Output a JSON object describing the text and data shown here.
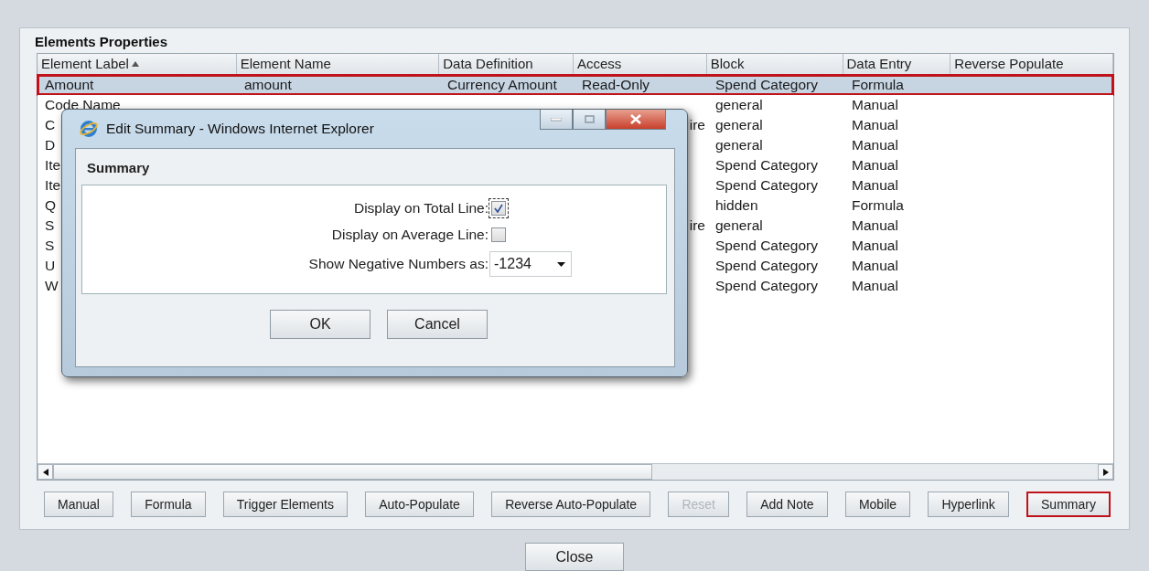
{
  "panel": {
    "title": "Elements Properties"
  },
  "table": {
    "columns": [
      {
        "label": "Element Label",
        "sorted": true
      },
      {
        "label": "Element Name",
        "sorted": false
      },
      {
        "label": "Data Definition",
        "sorted": false
      },
      {
        "label": "Access",
        "sorted": false
      },
      {
        "label": "Block",
        "sorted": false
      },
      {
        "label": "Data Entry",
        "sorted": false
      },
      {
        "label": "Reverse Populate",
        "sorted": false
      }
    ],
    "rows": [
      {
        "selected": true,
        "label": "Amount",
        "name": "amount",
        "definition": "Currency Amount",
        "access": "Read-Only",
        "block": "Spend Category",
        "entry": "Formula"
      },
      {
        "selected": false,
        "label": "Code Name",
        "block": "general",
        "entry": "Manual"
      },
      {
        "selected": false,
        "label": "C",
        "access": "ire",
        "block": "general",
        "entry": "Manual"
      },
      {
        "selected": false,
        "label": "D",
        "block": "general",
        "entry": "Manual"
      },
      {
        "selected": false,
        "label": "Ite",
        "block": "Spend Category",
        "entry": "Manual"
      },
      {
        "selected": false,
        "label": "Ite",
        "block": "Spend Category",
        "entry": "Manual"
      },
      {
        "selected": false,
        "label": "Q",
        "block": "hidden",
        "entry": "Formula"
      },
      {
        "selected": false,
        "label": "S",
        "access": "ire",
        "block": "general",
        "entry": "Manual"
      },
      {
        "selected": false,
        "label": "S",
        "block": "Spend Category",
        "entry": "Manual"
      },
      {
        "selected": false,
        "label": "U",
        "block": "Spend Category",
        "entry": "Manual"
      },
      {
        "selected": false,
        "label": "W",
        "block": "Spend Category",
        "entry": "Manual"
      }
    ]
  },
  "buttons": [
    {
      "label": "Manual",
      "disabled": false,
      "selected": false
    },
    {
      "label": "Formula",
      "disabled": false,
      "selected": false
    },
    {
      "label": "Trigger Elements",
      "disabled": false,
      "selected": false
    },
    {
      "label": "Auto-Populate",
      "disabled": false,
      "selected": false
    },
    {
      "label": "Reverse Auto-Populate",
      "disabled": false,
      "selected": false
    },
    {
      "label": "Reset",
      "disabled": true,
      "selected": false
    },
    {
      "label": "Add Note",
      "disabled": false,
      "selected": false
    },
    {
      "label": "Mobile",
      "disabled": false,
      "selected": false
    },
    {
      "label": "Hyperlink",
      "disabled": false,
      "selected": false
    },
    {
      "label": "Summary",
      "disabled": false,
      "selected": true
    }
  ],
  "close_button": "Close",
  "dialog": {
    "title": "Edit Summary - Windows Internet Explorer",
    "heading": "Summary",
    "options": [
      {
        "kind": "checkbox",
        "label": "Display on Total Line:",
        "checked": true,
        "focused": true
      },
      {
        "kind": "checkbox",
        "label": "Display on Average Line:",
        "checked": false,
        "focused": false
      },
      {
        "kind": "select",
        "label": "Show Negative Numbers as:",
        "value": "-1234"
      }
    ],
    "buttons": [
      "OK",
      "Cancel"
    ]
  }
}
